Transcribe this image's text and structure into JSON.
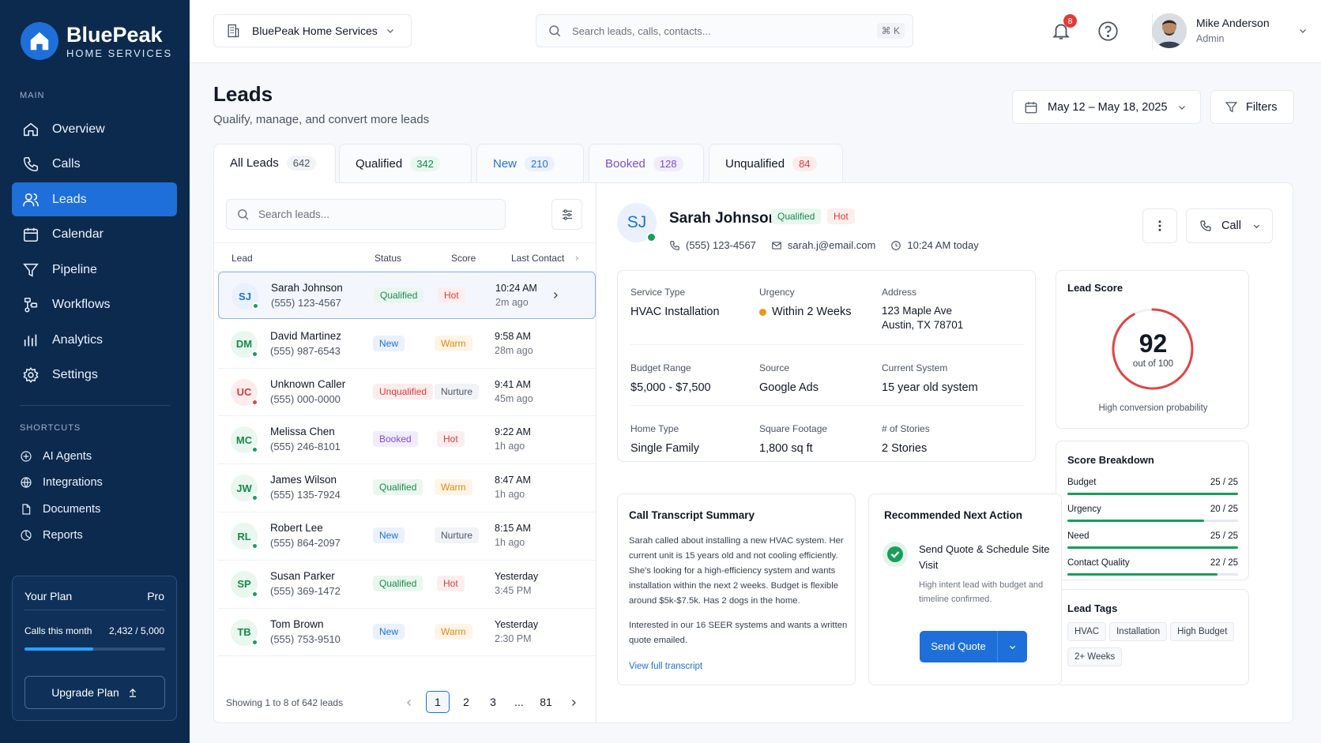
{
  "brand": {
    "name": "BluePeak",
    "subtitle": "HOME SERVICES"
  },
  "sidebar": {
    "main_label": "MAIN",
    "items": [
      {
        "label": "Overview"
      },
      {
        "label": "Calls"
      },
      {
        "label": "Leads"
      },
      {
        "label": "Calendar"
      },
      {
        "label": "Pipeline"
      },
      {
        "label": "Workflows"
      },
      {
        "label": "Analytics"
      },
      {
        "label": "Settings"
      }
    ],
    "shortcuts_label": "SHORTCUTS",
    "shortcuts": [
      {
        "label": "AI Agents"
      },
      {
        "label": "Integrations"
      },
      {
        "label": "Documents"
      },
      {
        "label": "Reports"
      }
    ],
    "plan": {
      "title": "Your Plan",
      "tier": "Pro",
      "usage_label": "Calls this month",
      "usage_value": "2,432 / 5,000",
      "usage_fraction": 0.486,
      "upgrade_label": "Upgrade Plan"
    }
  },
  "topbar": {
    "company": "BluePeak Home Services",
    "search_placeholder": "Search leads, calls, contacts...",
    "search_shortcut": "⌘ K",
    "notifications_count": "8",
    "user": {
      "name": "Mike Anderson",
      "role": "Admin"
    }
  },
  "page": {
    "title": "Leads",
    "subtitle": "Qualify, manage, and convert more leads",
    "date_range": "May 12 – May 18, 2025",
    "filters_label": "Filters"
  },
  "tabs": [
    {
      "label": "All Leads",
      "count": "642"
    },
    {
      "label": "Qualified",
      "count": "342"
    },
    {
      "label": "New",
      "count": "210"
    },
    {
      "label": "Booked",
      "count": "128"
    },
    {
      "label": "Unqualified",
      "count": "84"
    }
  ],
  "list": {
    "search_placeholder": "Search leads...",
    "columns": {
      "lead": "Lead",
      "status": "Status",
      "score": "Score",
      "last_contact": "Last Contact"
    },
    "rows": [
      {
        "initials": "SJ",
        "name": "Sarah Johnson",
        "phone": "(555) 123-4567",
        "status": "Qualified",
        "score": "Hot",
        "time": "10:24 AM",
        "ago": "2m ago"
      },
      {
        "initials": "DM",
        "name": "David Martinez",
        "phone": "(555) 987-6543",
        "status": "New",
        "score": "Warm",
        "time": "9:58 AM",
        "ago": "28m ago"
      },
      {
        "initials": "UC",
        "name": "Unknown Caller",
        "phone": "(555) 000-0000",
        "status": "Unqualified",
        "score": "Nurture",
        "time": "9:41 AM",
        "ago": "45m ago"
      },
      {
        "initials": "MC",
        "name": "Melissa Chen",
        "phone": "(555) 246-8101",
        "status": "Booked",
        "score": "Hot",
        "time": "9:22 AM",
        "ago": "1h ago"
      },
      {
        "initials": "JW",
        "name": "James Wilson",
        "phone": "(555) 135-7924",
        "status": "Qualified",
        "score": "Warm",
        "time": "8:47 AM",
        "ago": "1h ago"
      },
      {
        "initials": "RL",
        "name": "Robert Lee",
        "phone": "(555) 864-2097",
        "status": "New",
        "score": "Nurture",
        "time": "8:15 AM",
        "ago": "1h ago"
      },
      {
        "initials": "SP",
        "name": "Susan Parker",
        "phone": "(555) 369-1472",
        "status": "Qualified",
        "score": "Hot",
        "time": "Yesterday",
        "ago": "3:45 PM"
      },
      {
        "initials": "TB",
        "name": "Tom Brown",
        "phone": "(555) 753-9510",
        "status": "New",
        "score": "Warm",
        "time": "Yesterday",
        "ago": "2:30 PM"
      }
    ],
    "footer": "Showing 1 to 8 of 642 leads",
    "pages": [
      "1",
      "2",
      "3",
      "...",
      "81"
    ]
  },
  "detail": {
    "initials": "SJ",
    "name": "Sarah Johnson",
    "status": "Qualified",
    "score": "Hot",
    "phone": "(555) 123-4567",
    "email": "sarah.j@email.com",
    "time": "10:24 AM today",
    "call_label": "Call",
    "fields": {
      "service_type_label": "Service Type",
      "service_type": "HVAC Installation",
      "urgency_label": "Urgency",
      "urgency": "Within 2 Weeks",
      "address_label": "Address",
      "address_1": "123 Maple Ave",
      "address_2": "Austin, TX 78701",
      "budget_label": "Budget Range",
      "budget": "$5,000 - $7,500",
      "source_label": "Source",
      "source": "Google Ads",
      "system_label": "Current System",
      "system": "15 year old system",
      "home_label": "Home Type",
      "home": "Single Family",
      "sqft_label": "Square Footage",
      "sqft": "1,800 sq ft",
      "stories_label": "# of Stories",
      "stories": "2 Stories"
    },
    "lead_score": {
      "title": "Lead Score",
      "value": "92",
      "out_of": "out of 100",
      "fraction": 0.92,
      "caption": "High conversion probability"
    },
    "breakdown": {
      "title": "Score Breakdown",
      "items": [
        {
          "label": "Budget",
          "value": "25 / 25",
          "fraction": 1.0
        },
        {
          "label": "Urgency",
          "value": "20 / 25",
          "fraction": 0.8
        },
        {
          "label": "Need",
          "value": "25 / 25",
          "fraction": 1.0
        },
        {
          "label": "Contact Quality",
          "value": "22 / 25",
          "fraction": 0.88
        }
      ]
    },
    "tags": {
      "title": "Lead Tags",
      "items": [
        "HVAC",
        "Installation",
        "High Budget",
        "2+ Weeks"
      ]
    },
    "transcript": {
      "title": "Call Transcript Summary",
      "para1": "Sarah called about installing a new HVAC system. Her current unit is 15 years old and not cooling efficiently. She's looking for a high-efficiency system and wants installation within the next 2 weeks. Budget is flexible around $5k-$7.5k. Has 2 dogs in the home.",
      "para2": "Interested in our 16 SEER systems and wants a written quote emailed.",
      "link": "View full transcript"
    },
    "next_action": {
      "title": "Recommended Next Action",
      "action": "Send Quote & Schedule Site Visit",
      "desc": "High intent lead with budget and timeline confirmed.",
      "button": "Send Quote"
    }
  }
}
